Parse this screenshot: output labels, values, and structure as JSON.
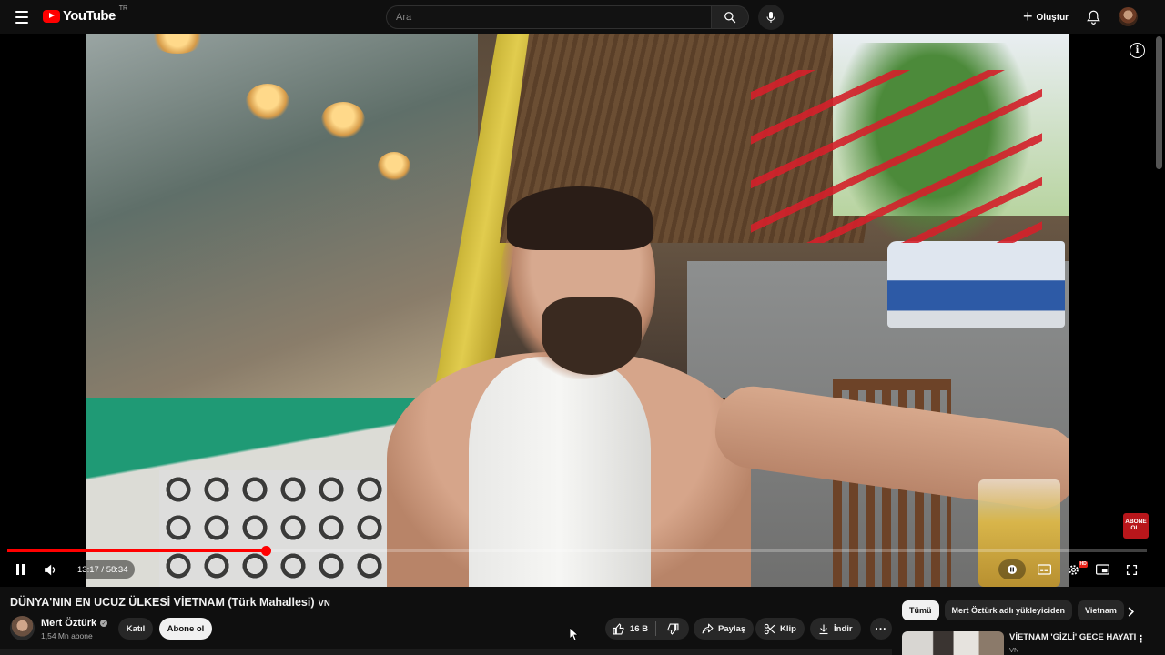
{
  "header": {
    "logo_text": "YouTube",
    "country_code": "TR",
    "search_placeholder": "Ara",
    "create_label": "Oluştur",
    "icons": [
      "menu-icon",
      "search-icon",
      "mic-icon",
      "plus-icon",
      "bell-icon"
    ]
  },
  "player": {
    "time_current": "13:17",
    "time_separator": " / ",
    "time_total": "58:34",
    "progress_fraction": 0.227,
    "watermark_line1": "ABONE",
    "watermark_line2": "OL!",
    "hd_badge": "HD",
    "colors": {
      "progress": "#ff0000",
      "watermark": "#b8161b"
    }
  },
  "video": {
    "title": "DÜNYA'NIN EN UCUZ ÜLKESİ VİETNAM (Türk Mahallesi)",
    "title_tag": "VN",
    "channel_name": "Mert Öztürk",
    "subscribers": "1,54 Mn abone",
    "join_label": "Katıl",
    "subscribe_label": "Abone ol",
    "likes": "16 B",
    "share_label": "Paylaş",
    "clip_label": "Klip",
    "download_label": "İndir"
  },
  "sidebar": {
    "chips": [
      "Tümü",
      "Mert Öztürk adlı yükleyiciden",
      "Vietnam"
    ],
    "active_chip": "Tümü",
    "recommendation": {
      "title": "VİETNAM 'GİZLİ' GECE HAYATI",
      "channel": "VN"
    }
  }
}
